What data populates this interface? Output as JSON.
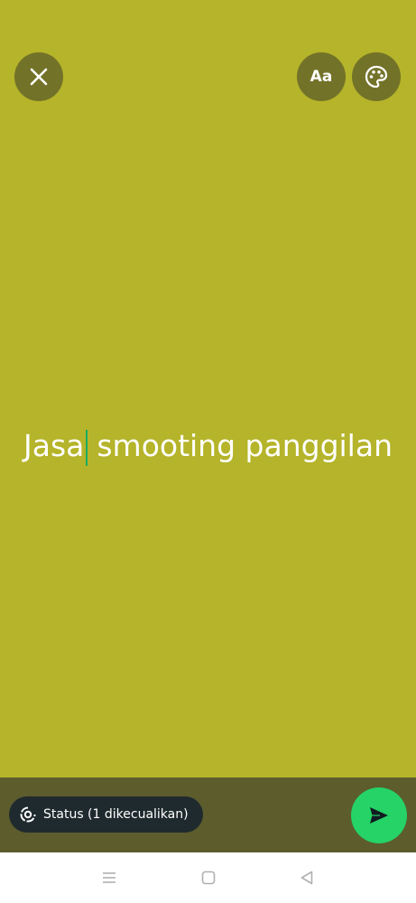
{
  "toolbar": {
    "close_icon": "close-icon",
    "font_label": "Aa",
    "palette_icon": "palette-icon"
  },
  "status": {
    "text_part1": "Jasa",
    "text_part2": "smooting panggilan",
    "background_color": "#b5b42a",
    "text_color": "#ffffff",
    "cursor_color": "#1daa61"
  },
  "bottom": {
    "audience_label": "Status (1 dikecualikan)",
    "audience_icon": "status-ring-icon",
    "send_icon": "send-icon",
    "send_color": "#25d366"
  },
  "navigation": {
    "menu_icon": "menu-icon",
    "home_icon": "home-icon",
    "back_icon": "back-icon"
  }
}
